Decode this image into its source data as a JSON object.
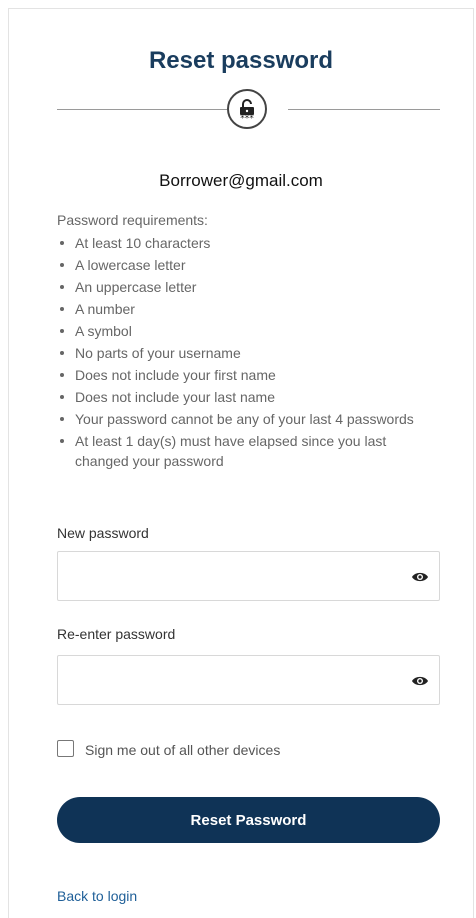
{
  "header": {
    "title": "Reset password",
    "icon": "lock-icon"
  },
  "account": {
    "email": "Borrower@gmail.com"
  },
  "requirements": {
    "title": "Password requirements:",
    "items": [
      "At least 10 characters",
      "A lowercase letter",
      "An uppercase letter",
      "A number",
      "A symbol",
      "No parts of your username",
      "Does not include your first name",
      "Does not include your last name",
      "Your password cannot be any of your last 4 passwords",
      "At least 1 day(s) must have elapsed since you last changed your password"
    ]
  },
  "form": {
    "new_password_label": "New password",
    "new_password_value": "",
    "reenter_password_label": "Re-enter password",
    "reenter_password_value": "",
    "toggle_icon": "eye-icon",
    "signout_label": "Sign me out of all other devices",
    "signout_checked": false,
    "submit_label": "Reset Password"
  },
  "footer": {
    "back_link": "Back to login"
  },
  "colors": {
    "accent": "#0f3356",
    "title": "#1a3d5e",
    "link": "#1f5f98"
  }
}
